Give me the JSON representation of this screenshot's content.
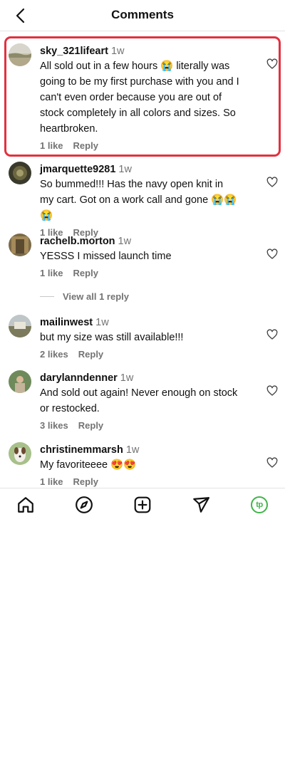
{
  "header": {
    "title": "Comments"
  },
  "comments": [
    {
      "username": "sky_321lifeart",
      "time": "1w",
      "text": "All sold out in a few hours 😭 literally was going to be my first purchase with you and I can't even order because you are out of stock completely in all colors and sizes. So heartbroken.",
      "likes": "1 like",
      "reply": "Reply"
    },
    {
      "username": "jmarquette9281",
      "time": "1w",
      "text": "So bummed!!! Has the navy open knit in my cart. Got on a work call and gone 😭😭😭",
      "likes": "1 like",
      "reply": "Reply"
    },
    {
      "username": "rachelb.morton",
      "time": "1w",
      "text": "YESSS I missed launch time",
      "likes": "1 like",
      "reply": "Reply"
    },
    {
      "username": "mailinwest",
      "time": "1w",
      "text": "but my size was still available!!!",
      "likes": "2 likes",
      "reply": "Reply"
    },
    {
      "username": "darylanndenner",
      "time": "1w",
      "text": "And sold out again! Never enough on stock or restocked.",
      "likes": "3 likes",
      "reply": "Reply"
    },
    {
      "username": "christinemmarsh",
      "time": "1w",
      "text": "My favoriteeee 😍😍",
      "likes": "1 like",
      "reply": "Reply"
    }
  ],
  "view_replies": {
    "label": "View all 1 reply"
  },
  "bottom_nav": {
    "items": [
      "home-icon",
      "explore-compass-icon",
      "create-plus-icon",
      "direct-message-icon",
      "profile-avatar"
    ],
    "profile_initials": "tp"
  },
  "colors": {
    "highlight": "#e2313f",
    "muted": "#737373",
    "profile_accent": "#3fb449"
  }
}
